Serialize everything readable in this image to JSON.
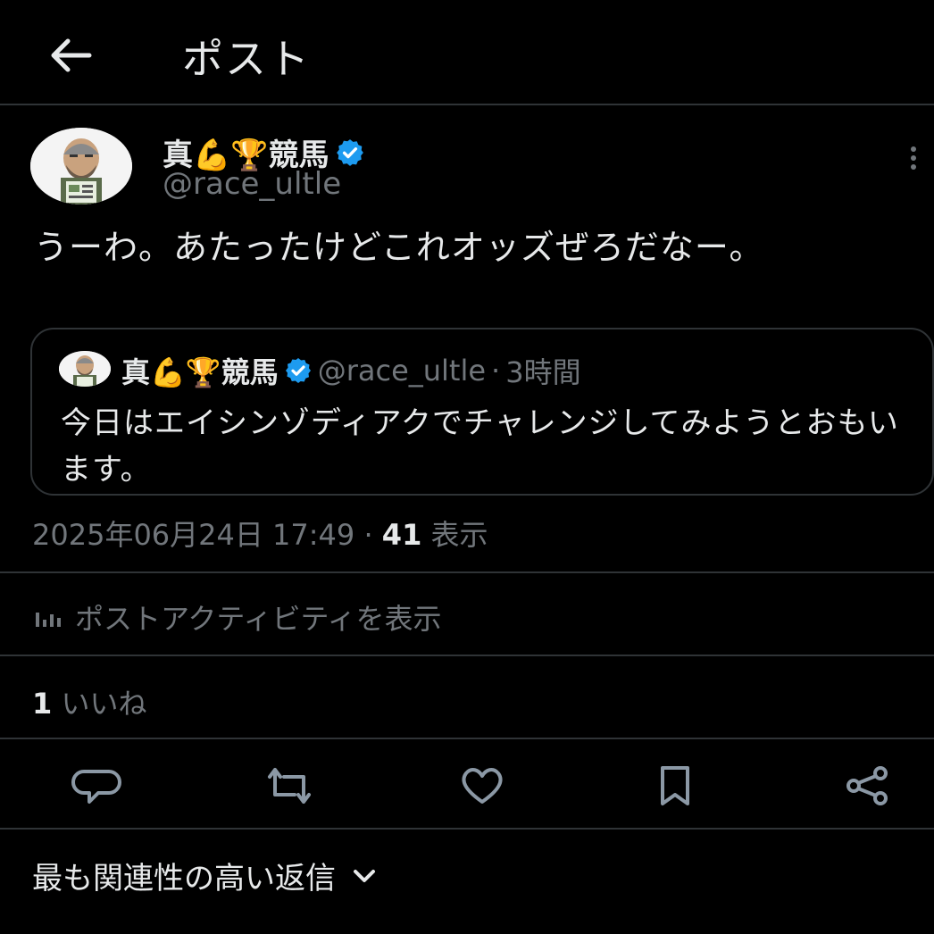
{
  "header": {
    "title": "ポスト"
  },
  "post": {
    "author_name": "真💪🏆競馬",
    "handle": "@race_ultle",
    "text": "うーわ。あたったけどこれオッズぜろだなー。",
    "quote": {
      "author_name": "真💪🏆競馬",
      "handle": "@race_ultle",
      "separator": "·",
      "time": "3時間",
      "text": "今日はエイシンゾディアクでチャレンジしてみようとおもいます。"
    },
    "timestamp": "2025年06月24日 17:49",
    "meta_separator": "·",
    "views_count": "41",
    "views_label": "表示",
    "activity_label": "ポストアクティビティを表示",
    "likes_count": "1",
    "likes_label": "いいね"
  },
  "replies": {
    "sort_label": "最も関連性の高い返信"
  },
  "icons": {
    "back": "arrow-left-icon",
    "verified": "verified-badge-icon",
    "more": "more-vertical-icon",
    "activity": "bar-chart-icon",
    "reply": "comment-icon",
    "repost": "repost-icon",
    "like": "heart-icon",
    "bookmark": "bookmark-icon",
    "share": "share-icon",
    "chevron": "chevron-down-icon"
  },
  "colors": {
    "background": "#000000",
    "text": "#e7e9ea",
    "muted": "#71767b",
    "verified": "#1d9bf0",
    "divider": "#2f3336"
  }
}
